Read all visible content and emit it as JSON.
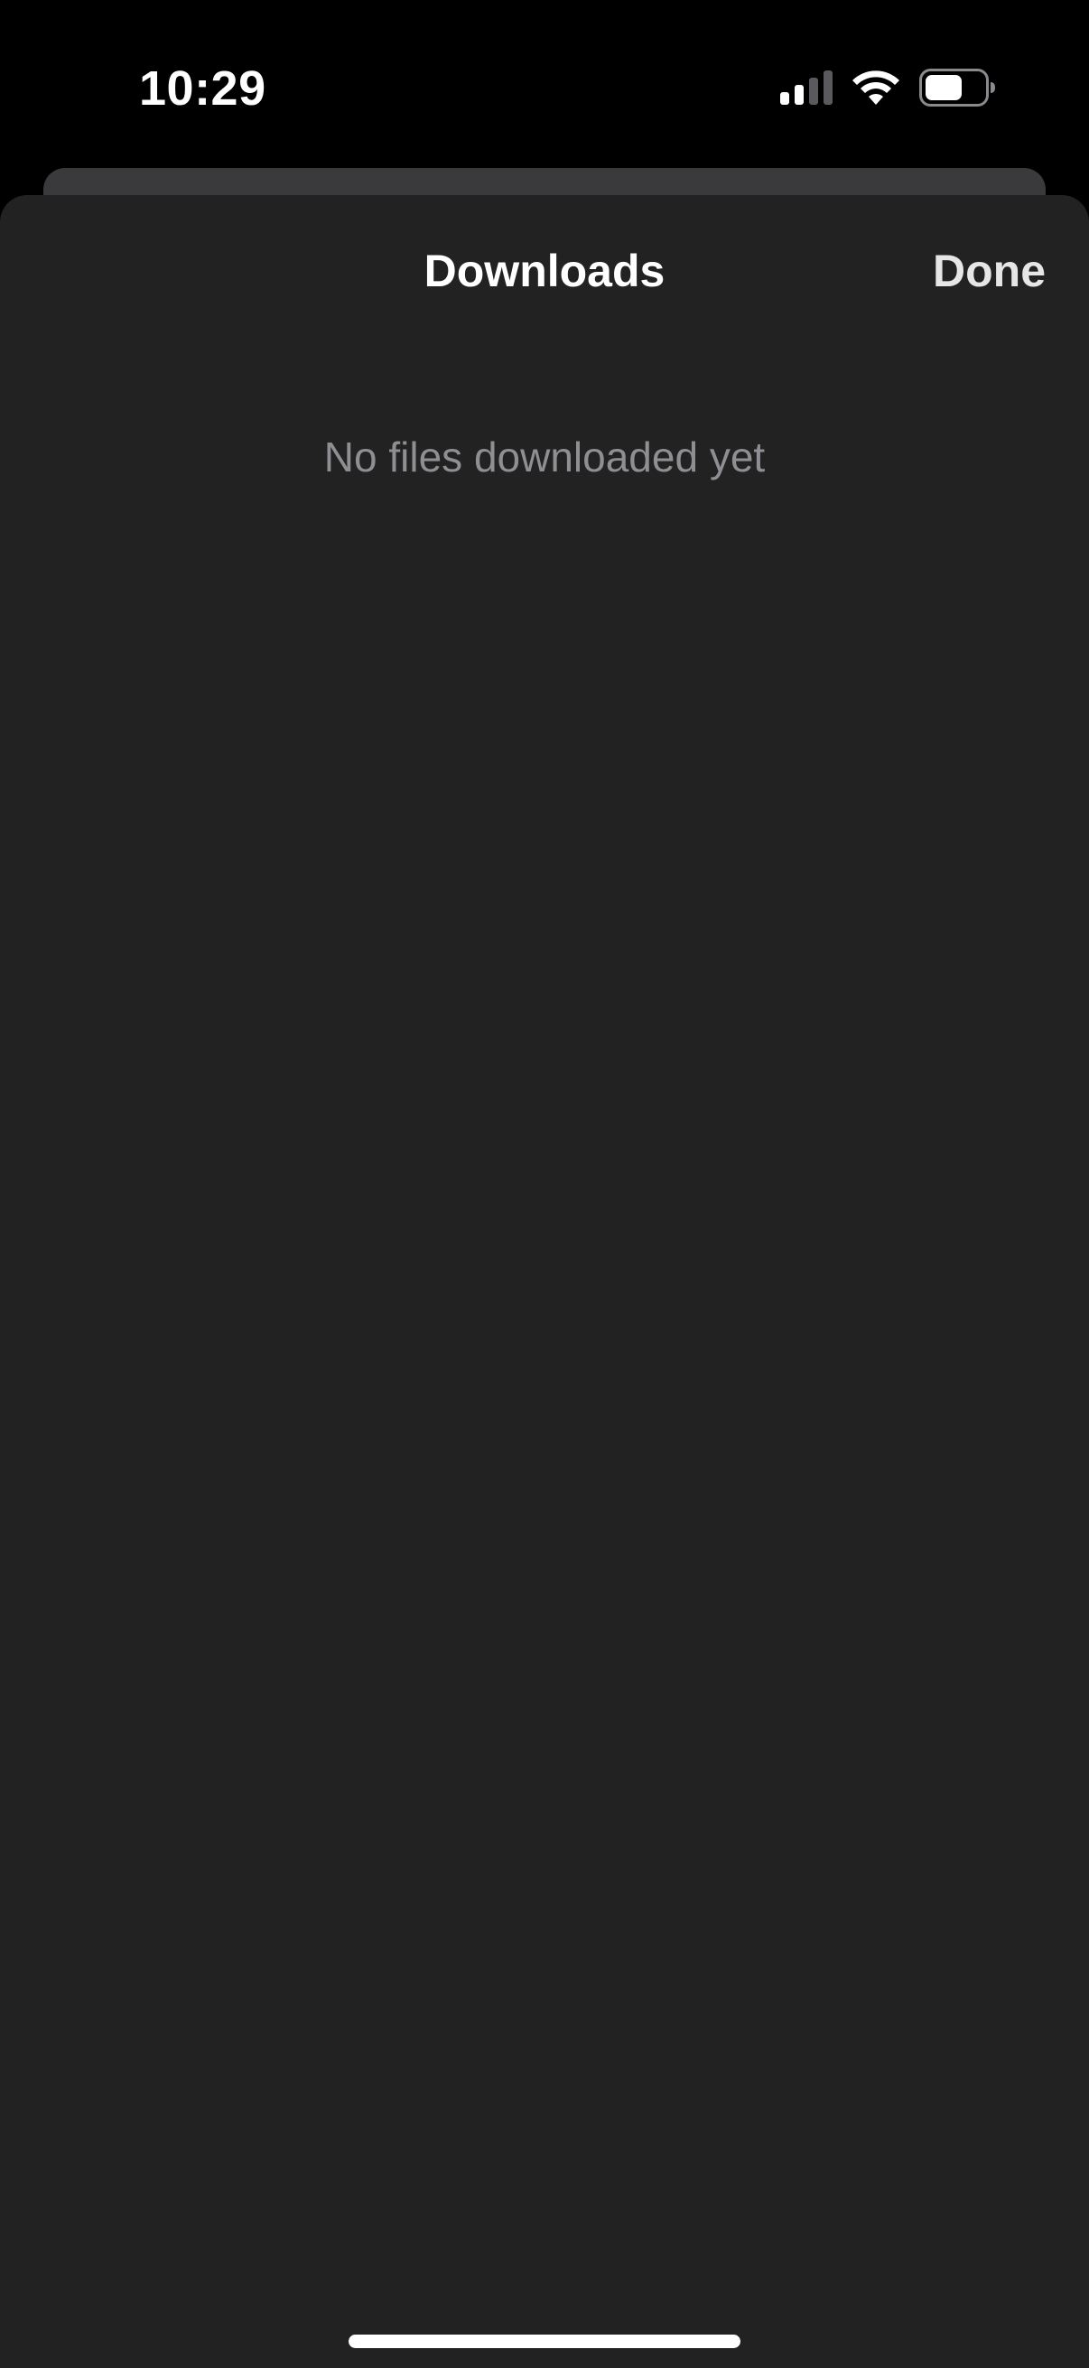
{
  "status_bar": {
    "time": "10:29",
    "signal_icon": "cellular-signal-icon",
    "wifi_icon": "wifi-icon",
    "battery_icon": "battery-icon"
  },
  "sheet": {
    "title": "Downloads",
    "done_label": "Done",
    "empty_message": "No files downloaded yet"
  },
  "colors": {
    "background": "#000000",
    "sheet_background": "#222222",
    "secondary_text": "#8e8e93"
  }
}
